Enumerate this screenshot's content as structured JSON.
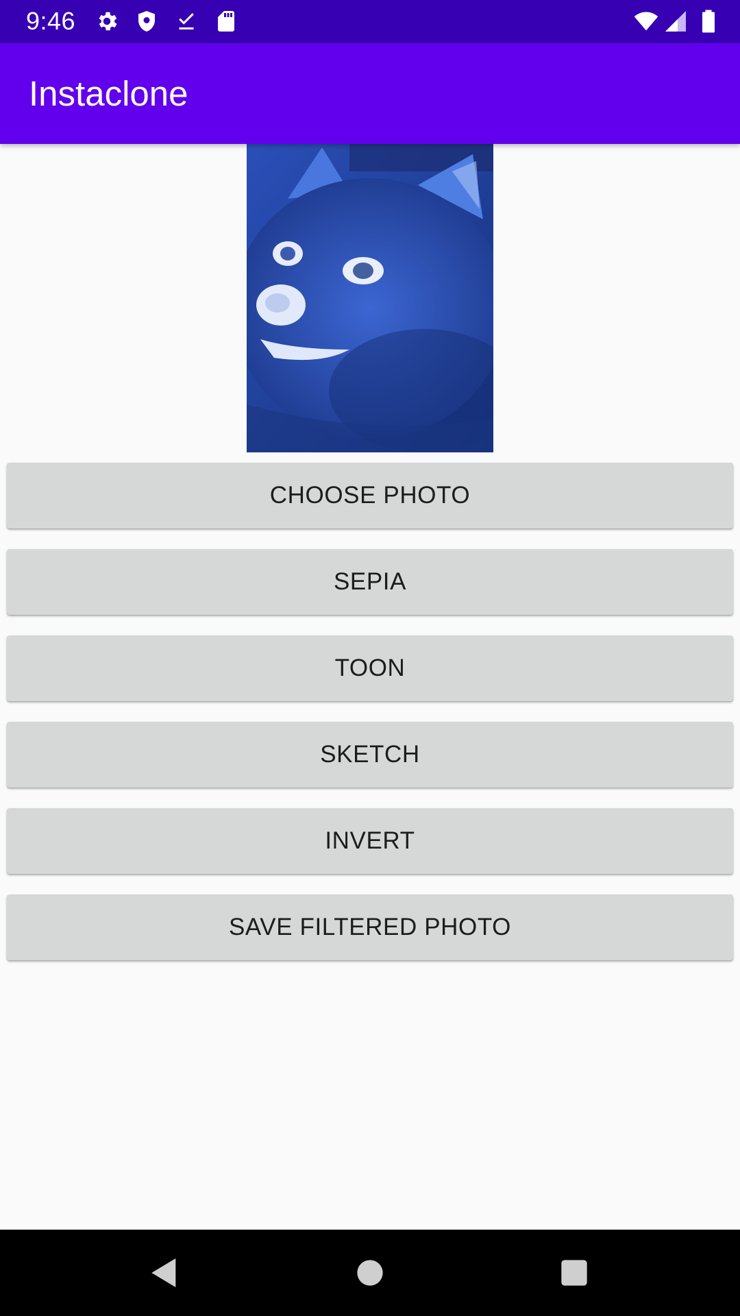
{
  "status_bar": {
    "time": "9:46",
    "background": "#3700b3",
    "left_icons": [
      "gear-icon",
      "shield-icon",
      "download-done-icon",
      "sd-card-icon"
    ],
    "right_icons": [
      "wifi-icon",
      "cellular-signal-icon",
      "battery-icon"
    ]
  },
  "app_bar": {
    "title": "Instaclone",
    "background": "#6200ee"
  },
  "photo": {
    "description_icon": "filtered-dog-photo",
    "tint": "#1f3e99"
  },
  "buttons": {
    "choose_photo": "CHOOSE PHOTO",
    "sepia": "SEPIA",
    "toon": "TOON",
    "sketch": "SKETCH",
    "invert": "INVERT",
    "save_filtered_photo": "SAVE FILTERED PHOTO"
  },
  "nav_bar": {
    "icons": [
      "back-icon",
      "home-icon",
      "recents-icon"
    ]
  }
}
